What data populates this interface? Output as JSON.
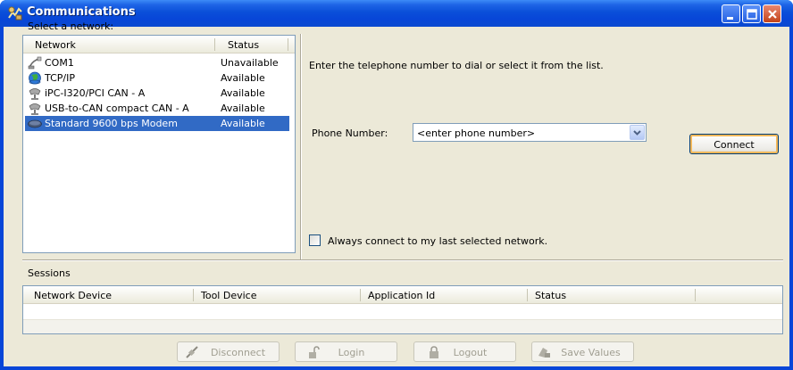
{
  "window": {
    "title": "Communications",
    "title_icon": "communications-icon",
    "controls": [
      "minimize-icon",
      "maximize-icon",
      "close-icon"
    ],
    "colors": {
      "titlebar": "#0846d8",
      "client": "#ece9d8",
      "selection": "#316ac5"
    }
  },
  "network_panel": {
    "label": "Select a network:",
    "columns": {
      "network": "Network",
      "status": "Status"
    },
    "items": [
      {
        "name": "COM1",
        "status": "Unavailable",
        "icon": "serial-port-icon",
        "selected": false
      },
      {
        "name": "TCP/IP",
        "status": "Available",
        "icon": "globe-network-icon",
        "selected": false
      },
      {
        "name": "iPC-I320/PCI CAN - A",
        "status": "Available",
        "icon": "can-adapter-icon",
        "selected": false
      },
      {
        "name": "USB-to-CAN compact CAN - A",
        "status": "Available",
        "icon": "can-adapter-icon",
        "selected": false
      },
      {
        "name": "Standard  9600 bps Modem",
        "status": "Available",
        "icon": "modem-icon",
        "selected": true
      }
    ]
  },
  "dial_panel": {
    "instruction": "Enter the telephone number to dial or select it from the list.",
    "phone_label": "Phone Number:",
    "phone_value": "<enter phone number>",
    "connect_label": "Connect",
    "always_connect_label": "Always connect to my last selected network.",
    "always_connect_checked": false
  },
  "sessions": {
    "label": "Sessions",
    "columns": [
      "Network Device",
      "Tool Device",
      "Application Id",
      "Status"
    ],
    "rows": []
  },
  "actions": {
    "disconnect": {
      "label": "Disconnect",
      "icon": "disconnect-icon",
      "enabled": false
    },
    "login": {
      "label": "Login",
      "icon": "unlock-icon",
      "enabled": false
    },
    "logout": {
      "label": "Logout",
      "icon": "lock-icon",
      "enabled": false
    },
    "save_values": {
      "label": "Save Values",
      "icon": "save-values-icon",
      "enabled": false
    }
  }
}
